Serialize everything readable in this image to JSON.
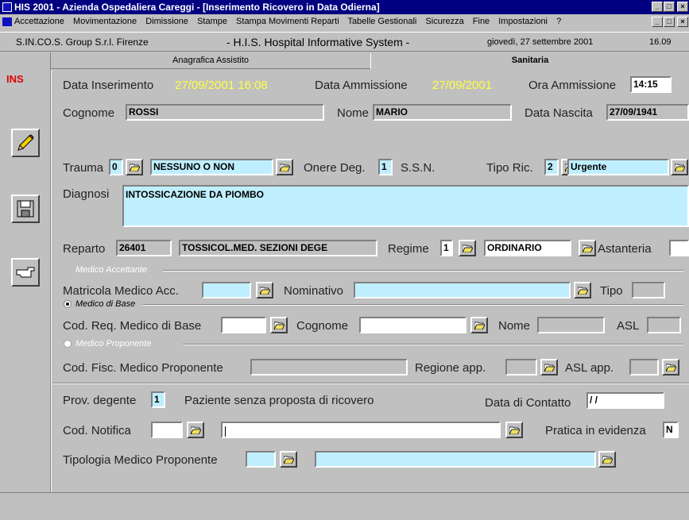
{
  "window": {
    "title": "HIS 2001 - Azienda Ospedaliera Careggi - [Inserimento Ricovero in Data Odierna]",
    "min": "_",
    "max": "□",
    "close": "×"
  },
  "menu": [
    "Accettazione",
    "Movimentazione",
    "Dimissione",
    "Stampe",
    "Stampa Movimenti Reparti",
    "Tabelle Gestionali",
    "Sicurezza",
    "Fine",
    "Impostazioni",
    "?"
  ],
  "status": {
    "company": "S.IN.CO.S. Group S.r.l. Firenze",
    "system": "- H.I.S. Hospital Informative System -",
    "date": "giovedì, 27 settembre 2001",
    "time": "16.09"
  },
  "mode": "INS",
  "tabs": {
    "anagrafica": "Anagrafica Assistito",
    "sanitaria": "Sanitaria"
  },
  "labels": {
    "data_inserimento": "Data Inserimento",
    "data_ammissione": "Data Ammissione",
    "ora_ammissione": "Ora Ammissione",
    "cognome": "Cognome",
    "nome": "Nome",
    "data_nascita": "Data Nascita",
    "trauma": "Trauma",
    "onere_deg": "Onere Deg.",
    "ssn": "S.S.N.",
    "tipo_ric": "Tipo Ric.",
    "diagnosi": "Diagnosi",
    "reparto": "Reparto",
    "regime": "Regime",
    "astanteria": "Astanteria",
    "medico_accettante": "Medico Accettante",
    "matricola": "Matricola Medico Acc.",
    "nominativo": "Nominativo",
    "tipo": "Tipo",
    "medico_base": "Medico di Base",
    "cod_req": "Cod. Req. Medico di Base",
    "cognome2": "Cognome",
    "nome2": "Nome",
    "asl": "ASL",
    "medico_proponente": "Medico Proponente",
    "cod_fisc": "Cod. Fisc. Medico Proponente",
    "regione_app": "Regione app.",
    "asl_app": "ASL app.",
    "prov_degente": "Prov. degente",
    "paziente_senza": "Paziente senza proposta di ricovero",
    "data_contatto": "Data di Contatto",
    "cod_notifica": "Cod. Notifica",
    "pratica": "Pratica in evidenza",
    "tipologia": "Tipologia Medico Proponente"
  },
  "values": {
    "data_inserimento": "27/09/2001 16:08",
    "data_ammissione": "27/09/2001",
    "ora_ammissione": "14:15",
    "cognome": "ROSSI",
    "nome": "MARIO",
    "data_nascita": "27/09/1941",
    "trauma_code": "0",
    "trauma_desc": "NESSUNO O NON",
    "onere_code": "1",
    "tipo_ric_code": "2",
    "tipo_ric_desc": "Urgente",
    "diagnosi": "INTOSSICAZIONE DA PIOMBO",
    "reparto_code": "26401",
    "reparto_desc": "TOSSICOL.MED. SEZIONI DEGE",
    "regime_code": "1",
    "regime_desc": "ORDINARIO",
    "prov_degente": "1",
    "data_contatto": "/ /",
    "pratica": "N"
  },
  "icons": {
    "pencil": "pencil-icon",
    "save": "floppy-disk-icon",
    "hand": "pointing-hand-icon",
    "folder": "open-folder-icon"
  }
}
